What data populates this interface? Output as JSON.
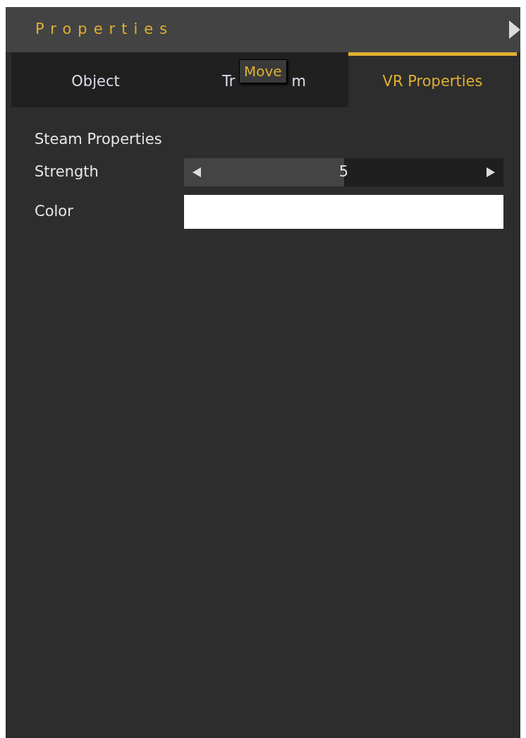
{
  "panel": {
    "title": "Properties"
  },
  "tabs": [
    {
      "label_start": "Object",
      "selected": false
    },
    {
      "label_start": "Tr",
      "label_end": "m",
      "selected": false
    },
    {
      "label_start": "VR Properties",
      "selected": true
    }
  ],
  "tooltip": {
    "text": "Move"
  },
  "section": {
    "title": "Steam Properties"
  },
  "properties": [
    {
      "kind": "slider",
      "label": "Strength",
      "value": "5",
      "level": 0.5
    },
    {
      "kind": "color",
      "label": "Color",
      "color": "#ffffff"
    }
  ]
}
